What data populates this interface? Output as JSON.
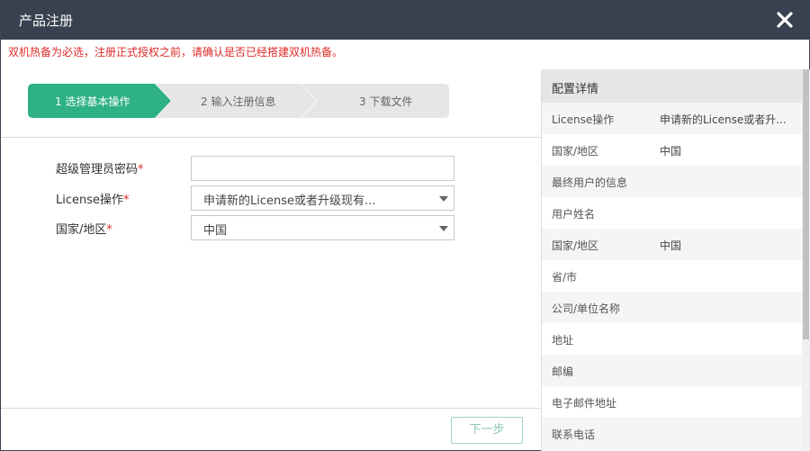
{
  "dialog": {
    "title": "产品注册",
    "notice": "双机热备为必选，注册正式授权之前，请确认是否已经搭建双机热备。"
  },
  "steps": [
    {
      "label": "1 选择基本操作",
      "active": true
    },
    {
      "label": "2 输入注册信息",
      "active": false
    },
    {
      "label": "3 下载文件",
      "active": false
    }
  ],
  "form": {
    "password_label": "超级管理员密码",
    "password_value": "",
    "license_label": "License操作",
    "license_value": "申请新的License或者升级现有...",
    "country_label": "国家/地区",
    "country_value": "中国",
    "required_mark": "*"
  },
  "buttons": {
    "next": "下一步"
  },
  "panel": {
    "title": "配置详情",
    "rows": [
      {
        "key": "License操作",
        "value": "申请新的License或者升..."
      },
      {
        "key": "国家/地区",
        "value": "中国"
      },
      {
        "key": "最终用户的信息",
        "value": ""
      },
      {
        "key": "用户姓名",
        "value": ""
      },
      {
        "key": "国家/地区",
        "value": "中国"
      },
      {
        "key": "省/市",
        "value": ""
      },
      {
        "key": "公司/单位名称",
        "value": ""
      },
      {
        "key": "地址",
        "value": ""
      },
      {
        "key": "邮编",
        "value": ""
      },
      {
        "key": "电子邮件地址",
        "value": ""
      },
      {
        "key": "联系电话",
        "value": ""
      }
    ]
  },
  "colors": {
    "titlebar": "#38414f",
    "active_step": "#2eb183",
    "inactive_step": "#e6e6e6",
    "required": "#e02a2a"
  },
  "icons": {
    "close": "close-icon",
    "dropdown": "chevron-down-icon"
  }
}
